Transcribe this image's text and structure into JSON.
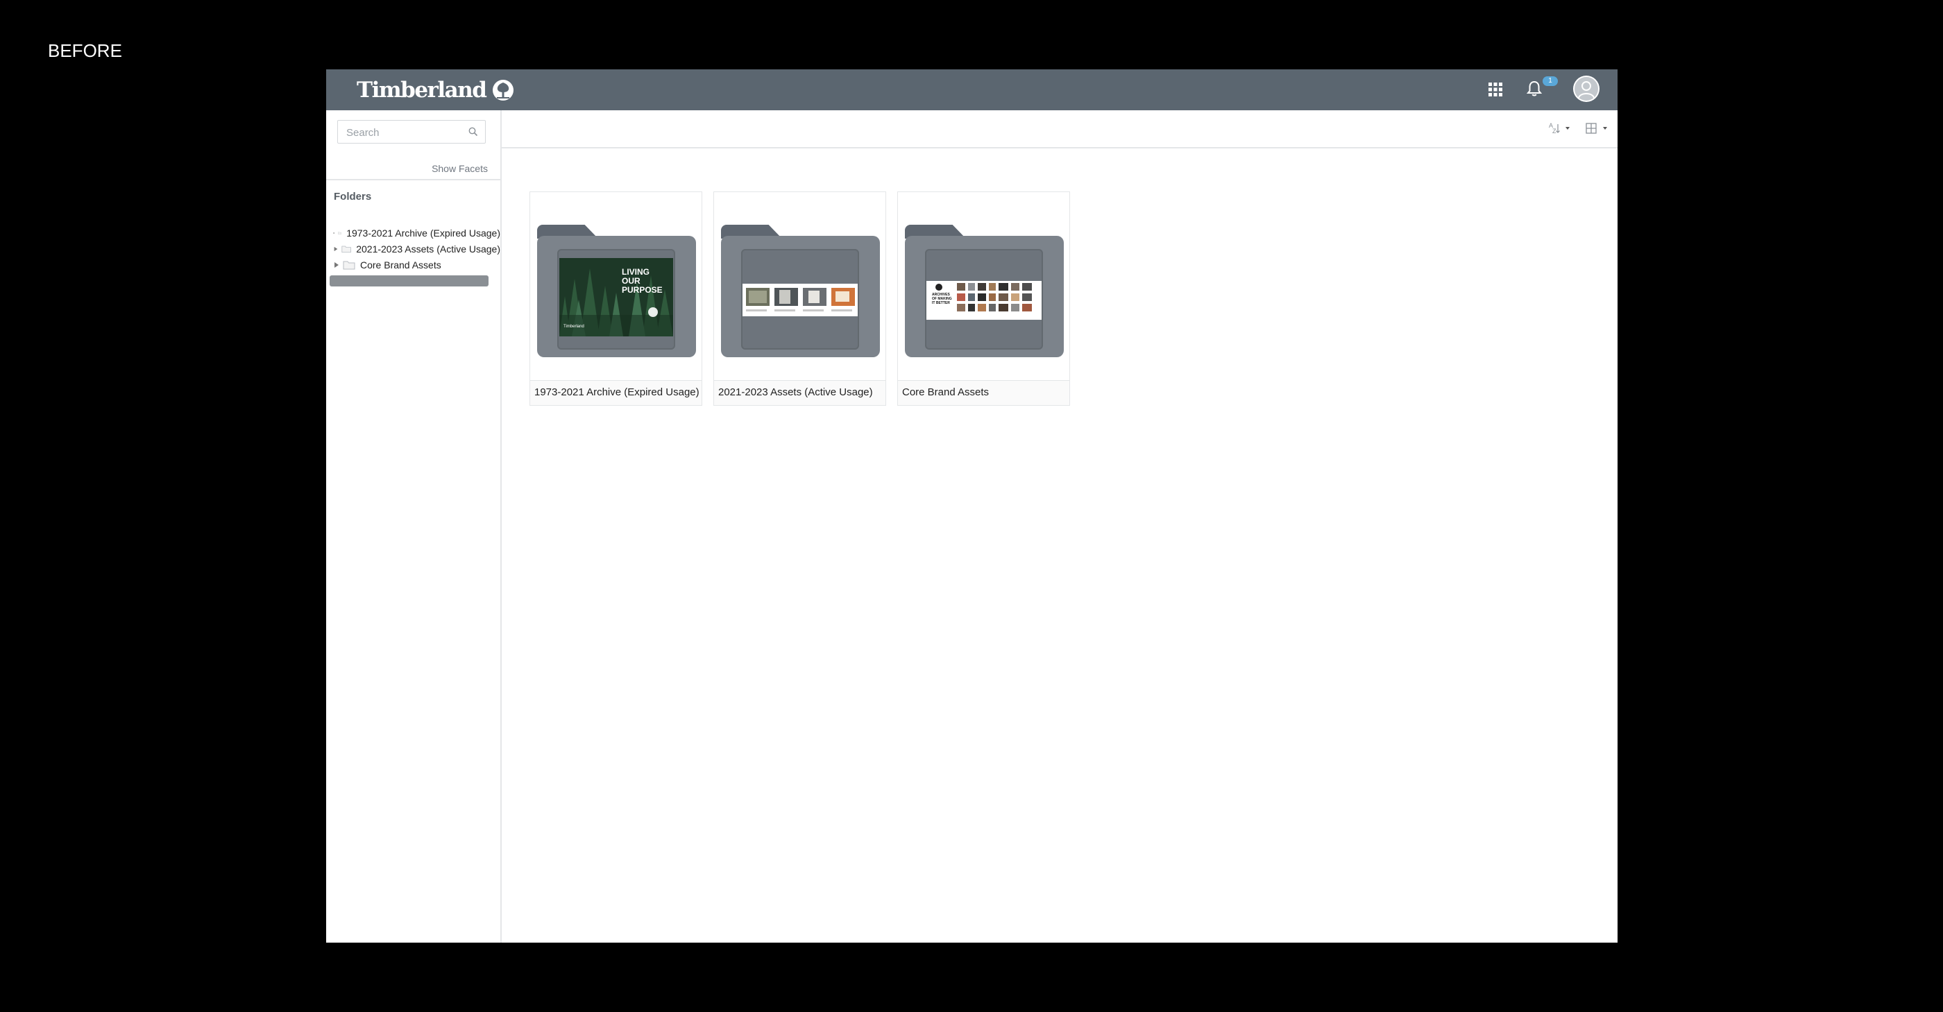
{
  "caption": "BEFORE",
  "header": {
    "brand": "Timberland",
    "notification_count": "1"
  },
  "sidebar": {
    "search_placeholder": "Search",
    "show_facets": "Show Facets",
    "folders_heading": "Folders",
    "tree": [
      {
        "label": "1973-2021 Archive (Expired Usage)"
      },
      {
        "label": "2021-2023 Assets (Active Usage)"
      },
      {
        "label": "Core Brand Assets"
      }
    ]
  },
  "toolbar": {
    "sort_icon": "sort-az-icon",
    "view_icon": "grid-view-icon"
  },
  "folders": [
    {
      "label": "1973-2021 Archive (Expired Usage)",
      "thumb_text": "LIVING OUR PURPOSE",
      "thumb_brand": "Timberland"
    },
    {
      "label": "2021-2023 Assets (Active Usage)"
    },
    {
      "label": "Core Brand Assets",
      "thumb_text": "ARCHIVES OF MAKING IT BETTER"
    }
  ],
  "colors": {
    "topbar": "#5b6670",
    "badge": "#5aa7d8",
    "folder": "#7c838b"
  }
}
